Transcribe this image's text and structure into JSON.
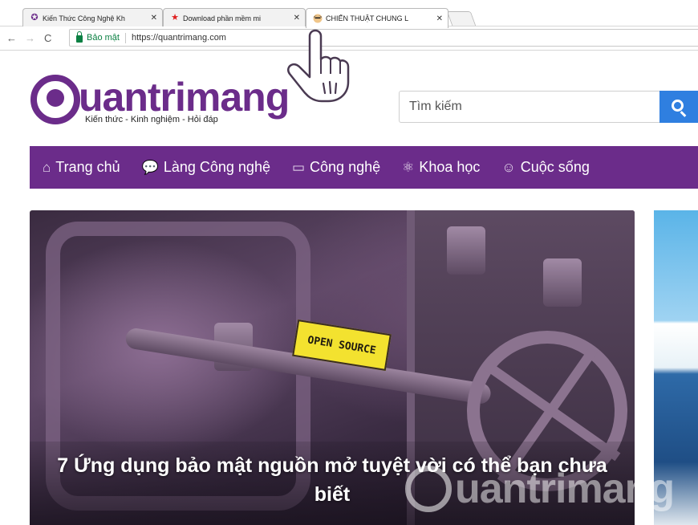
{
  "browser": {
    "tabs": [
      {
        "title": "Kiến Thức Công Nghệ Kh",
        "favicon": "quantrimang-icon",
        "active": false
      },
      {
        "title": "Download phần mềm mi",
        "favicon": "star-icon",
        "active": false
      },
      {
        "title": "CHIẾN THUẬT CHUNG L",
        "favicon": "avatar-icon",
        "active": true
      }
    ],
    "address": {
      "secure_label": "Bảo mật",
      "url": "https://quantrimang.com"
    }
  },
  "site": {
    "logo_text": "uantrimang",
    "tagline": "Kiến thức - Kinh nghiệm - Hỏi đáp",
    "search_placeholder": "Tìm kiếm",
    "nav": [
      {
        "label": "Trang chủ",
        "icon": "home-icon"
      },
      {
        "label": "Làng Công nghệ",
        "icon": "chat-icon"
      },
      {
        "label": "Công nghệ",
        "icon": "laptop-icon"
      },
      {
        "label": "Khoa học",
        "icon": "atom-icon"
      },
      {
        "label": "Cuộc sống",
        "icon": "lifebuoy-icon"
      }
    ]
  },
  "featured": {
    "badge_text": "OPEN SOURCE",
    "title": "7 Ứng dụng bảo mật nguồn mở tuyệt vời có thể bạn chưa biết",
    "watermark_text": "uantrimang"
  },
  "colors": {
    "brand_purple": "#6b2c8a",
    "search_blue": "#2f7fe0",
    "secure_green": "#0b8043"
  }
}
